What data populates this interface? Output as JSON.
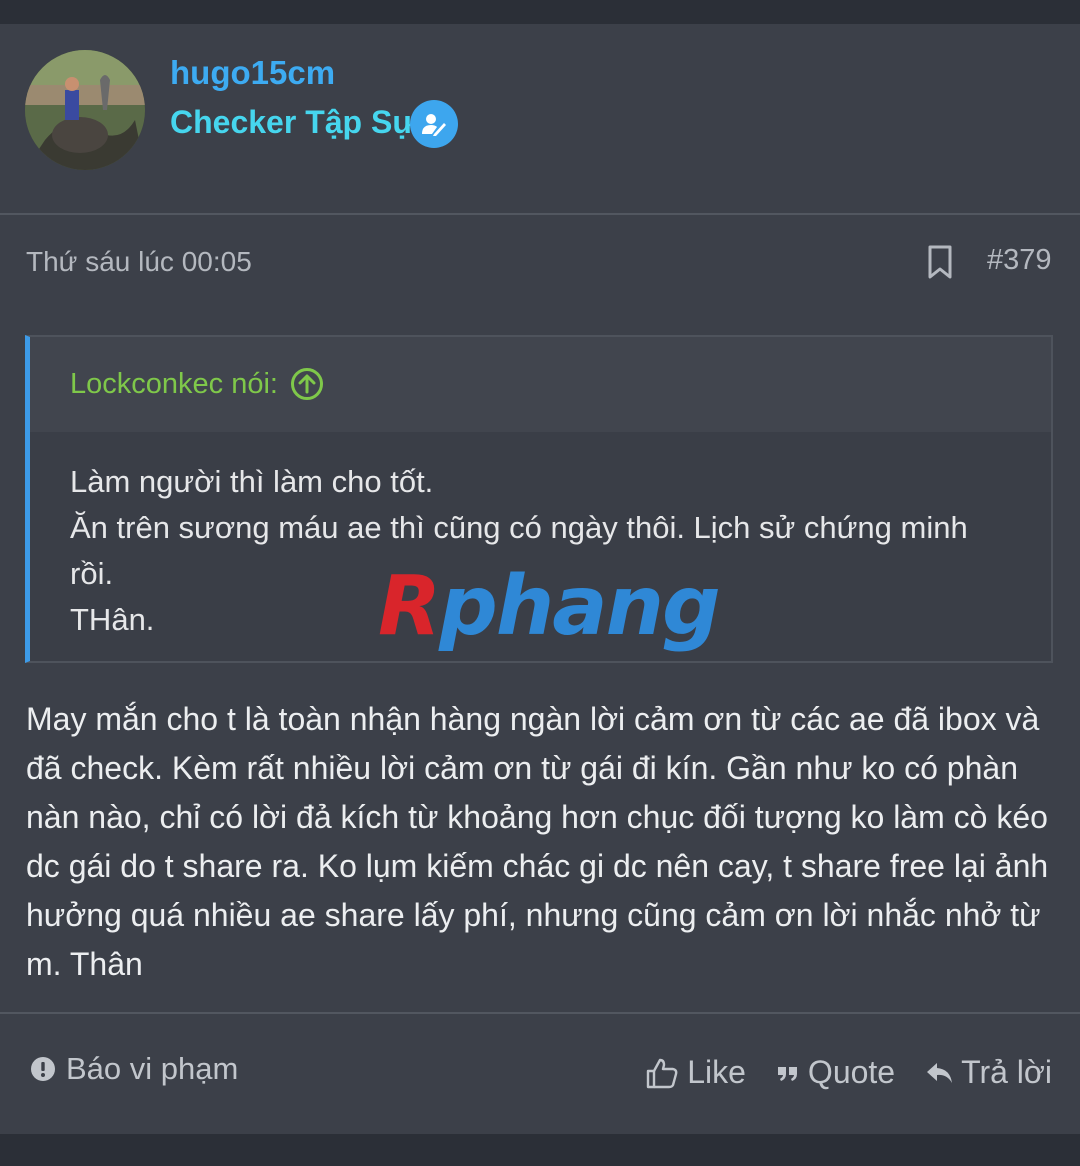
{
  "user": {
    "name": "hugo15cm",
    "title": "Checker Tập Sự"
  },
  "post": {
    "date": "Thứ sáu lúc 00:05",
    "number": "#379"
  },
  "quote": {
    "author": "Lockconkec nói:",
    "lines": [
      "Làm người thì làm cho tốt.",
      "Ăn trên sương máu ae thì cũng có ngày thôi. Lịch sử chứng minh\nrồi.",
      "THân."
    ]
  },
  "watermark": {
    "first": "R",
    "rest": "phang"
  },
  "message": "May mắn cho t là toàn nhận hàng ngàn lời cảm ơn từ các ae đã ibox và đã check. Kèm rất nhiều lời cảm ơn từ gái đi kín. Gần như ko có phàn nàn nào, chỉ có lời đả kích từ khoảng hơn chục đối tượng ko làm cò kéo dc gái do t share ra. Ko lụm kiếm chác gi dc nên cay, t share free lại ảnh hưởng quá nhiều ae share lấy phí, nhưng cũng cảm ơn lời nhắc nhở từ m. Thân",
  "footer": {
    "report": "Báo vi phạm",
    "like": "Like",
    "quote": "Quote",
    "reply": "Trả lời"
  },
  "colors": {
    "username": "#3dabf2",
    "usertitle": "#46d6ee",
    "quote_author": "#7fc84a",
    "quote_border": "#3d9be8"
  },
  "icons": [
    "user-edit-icon",
    "bookmark-icon",
    "arrow-up-circle-icon",
    "alert-circle-icon",
    "thumbs-up-icon",
    "quote-icon",
    "reply-icon"
  ]
}
